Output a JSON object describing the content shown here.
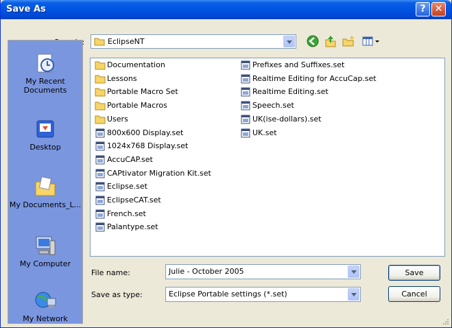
{
  "window": {
    "title": "Save As"
  },
  "title_buttons": {
    "help": "?",
    "close": "✕"
  },
  "location": {
    "label": "Save in:",
    "value": "EclipseNT"
  },
  "toolbar": {
    "back": "back-icon",
    "up": "up-folder-icon",
    "new_folder": "new-folder-icon",
    "views": "views-menu-icon"
  },
  "places": [
    {
      "label": "My Recent Documents",
      "icon": "recent-documents-icon"
    },
    {
      "label": "Desktop",
      "icon": "desktop-icon"
    },
    {
      "label": "My Documents_L...",
      "icon": "my-documents-icon"
    },
    {
      "label": "My Computer",
      "icon": "my-computer-icon"
    },
    {
      "label": "My Network",
      "icon": "my-network-icon"
    }
  ],
  "files": {
    "column1": [
      {
        "name": "Documentation",
        "type": "folder"
      },
      {
        "name": "Lessons",
        "type": "folder"
      },
      {
        "name": "Portable Macro Set",
        "type": "folder"
      },
      {
        "name": "Portable Macros",
        "type": "folder"
      },
      {
        "name": "Users",
        "type": "folder"
      },
      {
        "name": "800x600 Display.set",
        "type": "set"
      },
      {
        "name": "1024x768 Display.set",
        "type": "set"
      },
      {
        "name": "AccuCAP.set",
        "type": "set"
      },
      {
        "name": "CAPtivator Migration Kit.set",
        "type": "set"
      },
      {
        "name": "Eclipse.set",
        "type": "set"
      },
      {
        "name": "EclipseCAT.set",
        "type": "set"
      },
      {
        "name": "French.set",
        "type": "set"
      },
      {
        "name": "Palantype.set",
        "type": "set"
      }
    ],
    "column2": [
      {
        "name": "Prefixes and Suffixes.set",
        "type": "set"
      },
      {
        "name": "Realtime Editing for AccuCap.set",
        "type": "set"
      },
      {
        "name": "Realtime Editing.set",
        "type": "set"
      },
      {
        "name": "Speech.set",
        "type": "set"
      },
      {
        "name": "UK(ise-dollars).set",
        "type": "set"
      },
      {
        "name": "UK.set",
        "type": "set"
      }
    ]
  },
  "filename": {
    "label": "File name:",
    "value": "Julie - October 2005"
  },
  "filetype": {
    "label": "Save as type:",
    "value": "Eclipse Portable settings (*.set)"
  },
  "buttons": {
    "save": "Save",
    "cancel": "Cancel"
  },
  "colors": {
    "title_bar": "#0054e3",
    "places_bar": "#7a96df",
    "dialog_bg": "#ece9d8"
  }
}
